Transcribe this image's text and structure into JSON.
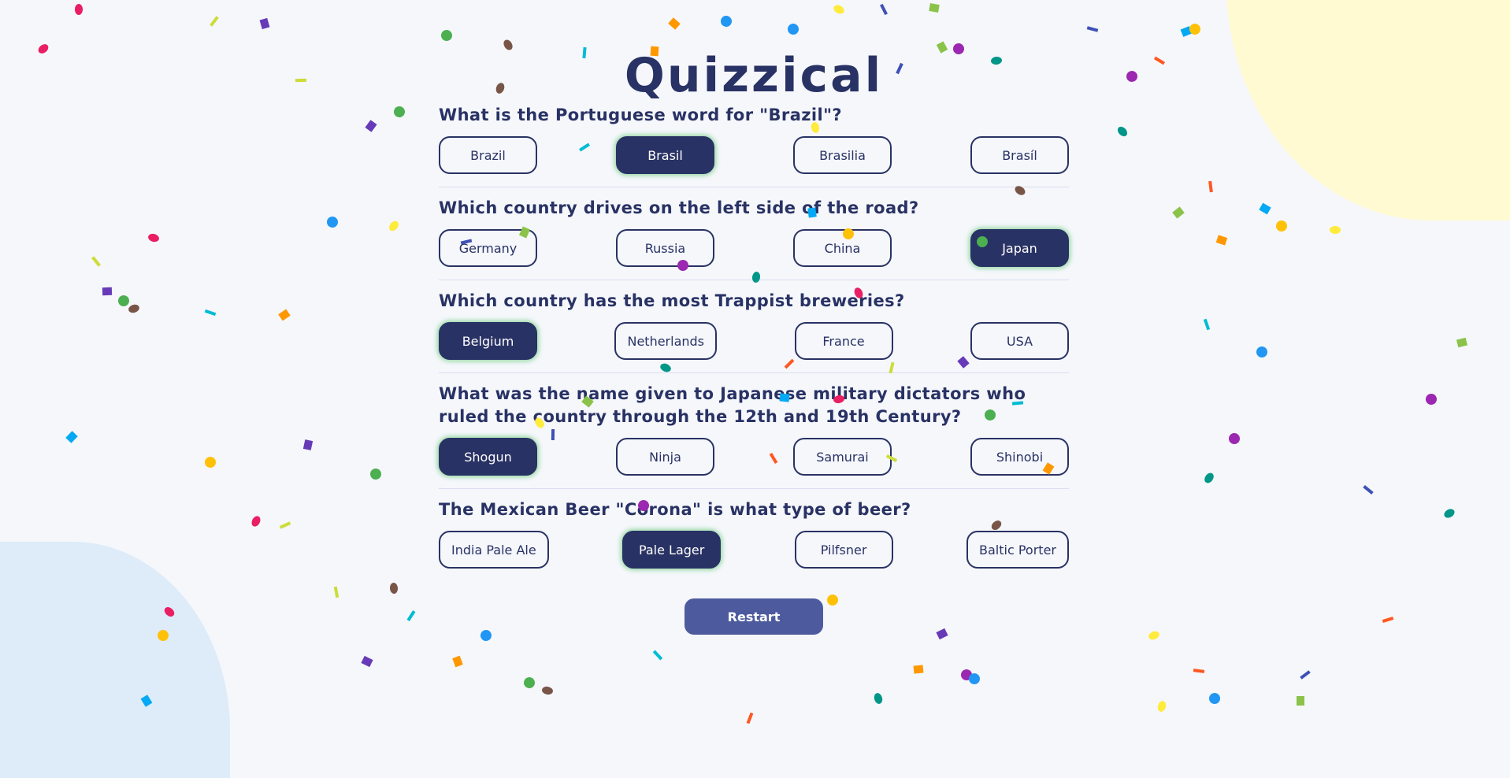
{
  "app": {
    "title": "Quizzical"
  },
  "questions": [
    {
      "text": "What is the Portuguese word for \"Brazil\"?",
      "answers": [
        "Brazil",
        "Brasil",
        "Brasilia",
        "Brasíl"
      ],
      "selected_index": 1
    },
    {
      "text": "Which country drives on the left side of the road?",
      "answers": [
        "Germany",
        "Russia",
        "China",
        "Japan"
      ],
      "selected_index": 3
    },
    {
      "text": "Which country has the most Trappist breweries?",
      "answers": [
        "Belgium",
        "Netherlands",
        "France",
        "USA"
      ],
      "selected_index": 0
    },
    {
      "text": "What was the name given to Japanese military dictators who ruled the country through the 12th and 19th Century?",
      "answers": [
        "Shogun",
        "Ninja",
        "Samurai",
        "Shinobi"
      ],
      "selected_index": 0
    },
    {
      "text": "The Mexican Beer \"Corona\" is what type of beer?",
      "answers": [
        "India Pale Ale",
        "Pale Lager",
        "Pilfsner",
        "Baltic Porter"
      ],
      "selected_index": 1
    }
  ],
  "restart_label": "Restart",
  "colors": {
    "primary": "#293264",
    "selected_glow": "#94D7A2",
    "restart_button": "#4D5B9E",
    "background": "#F5F7FB",
    "blob_yellow": "#FFFAD1",
    "blob_blue": "#DEEBF8"
  }
}
